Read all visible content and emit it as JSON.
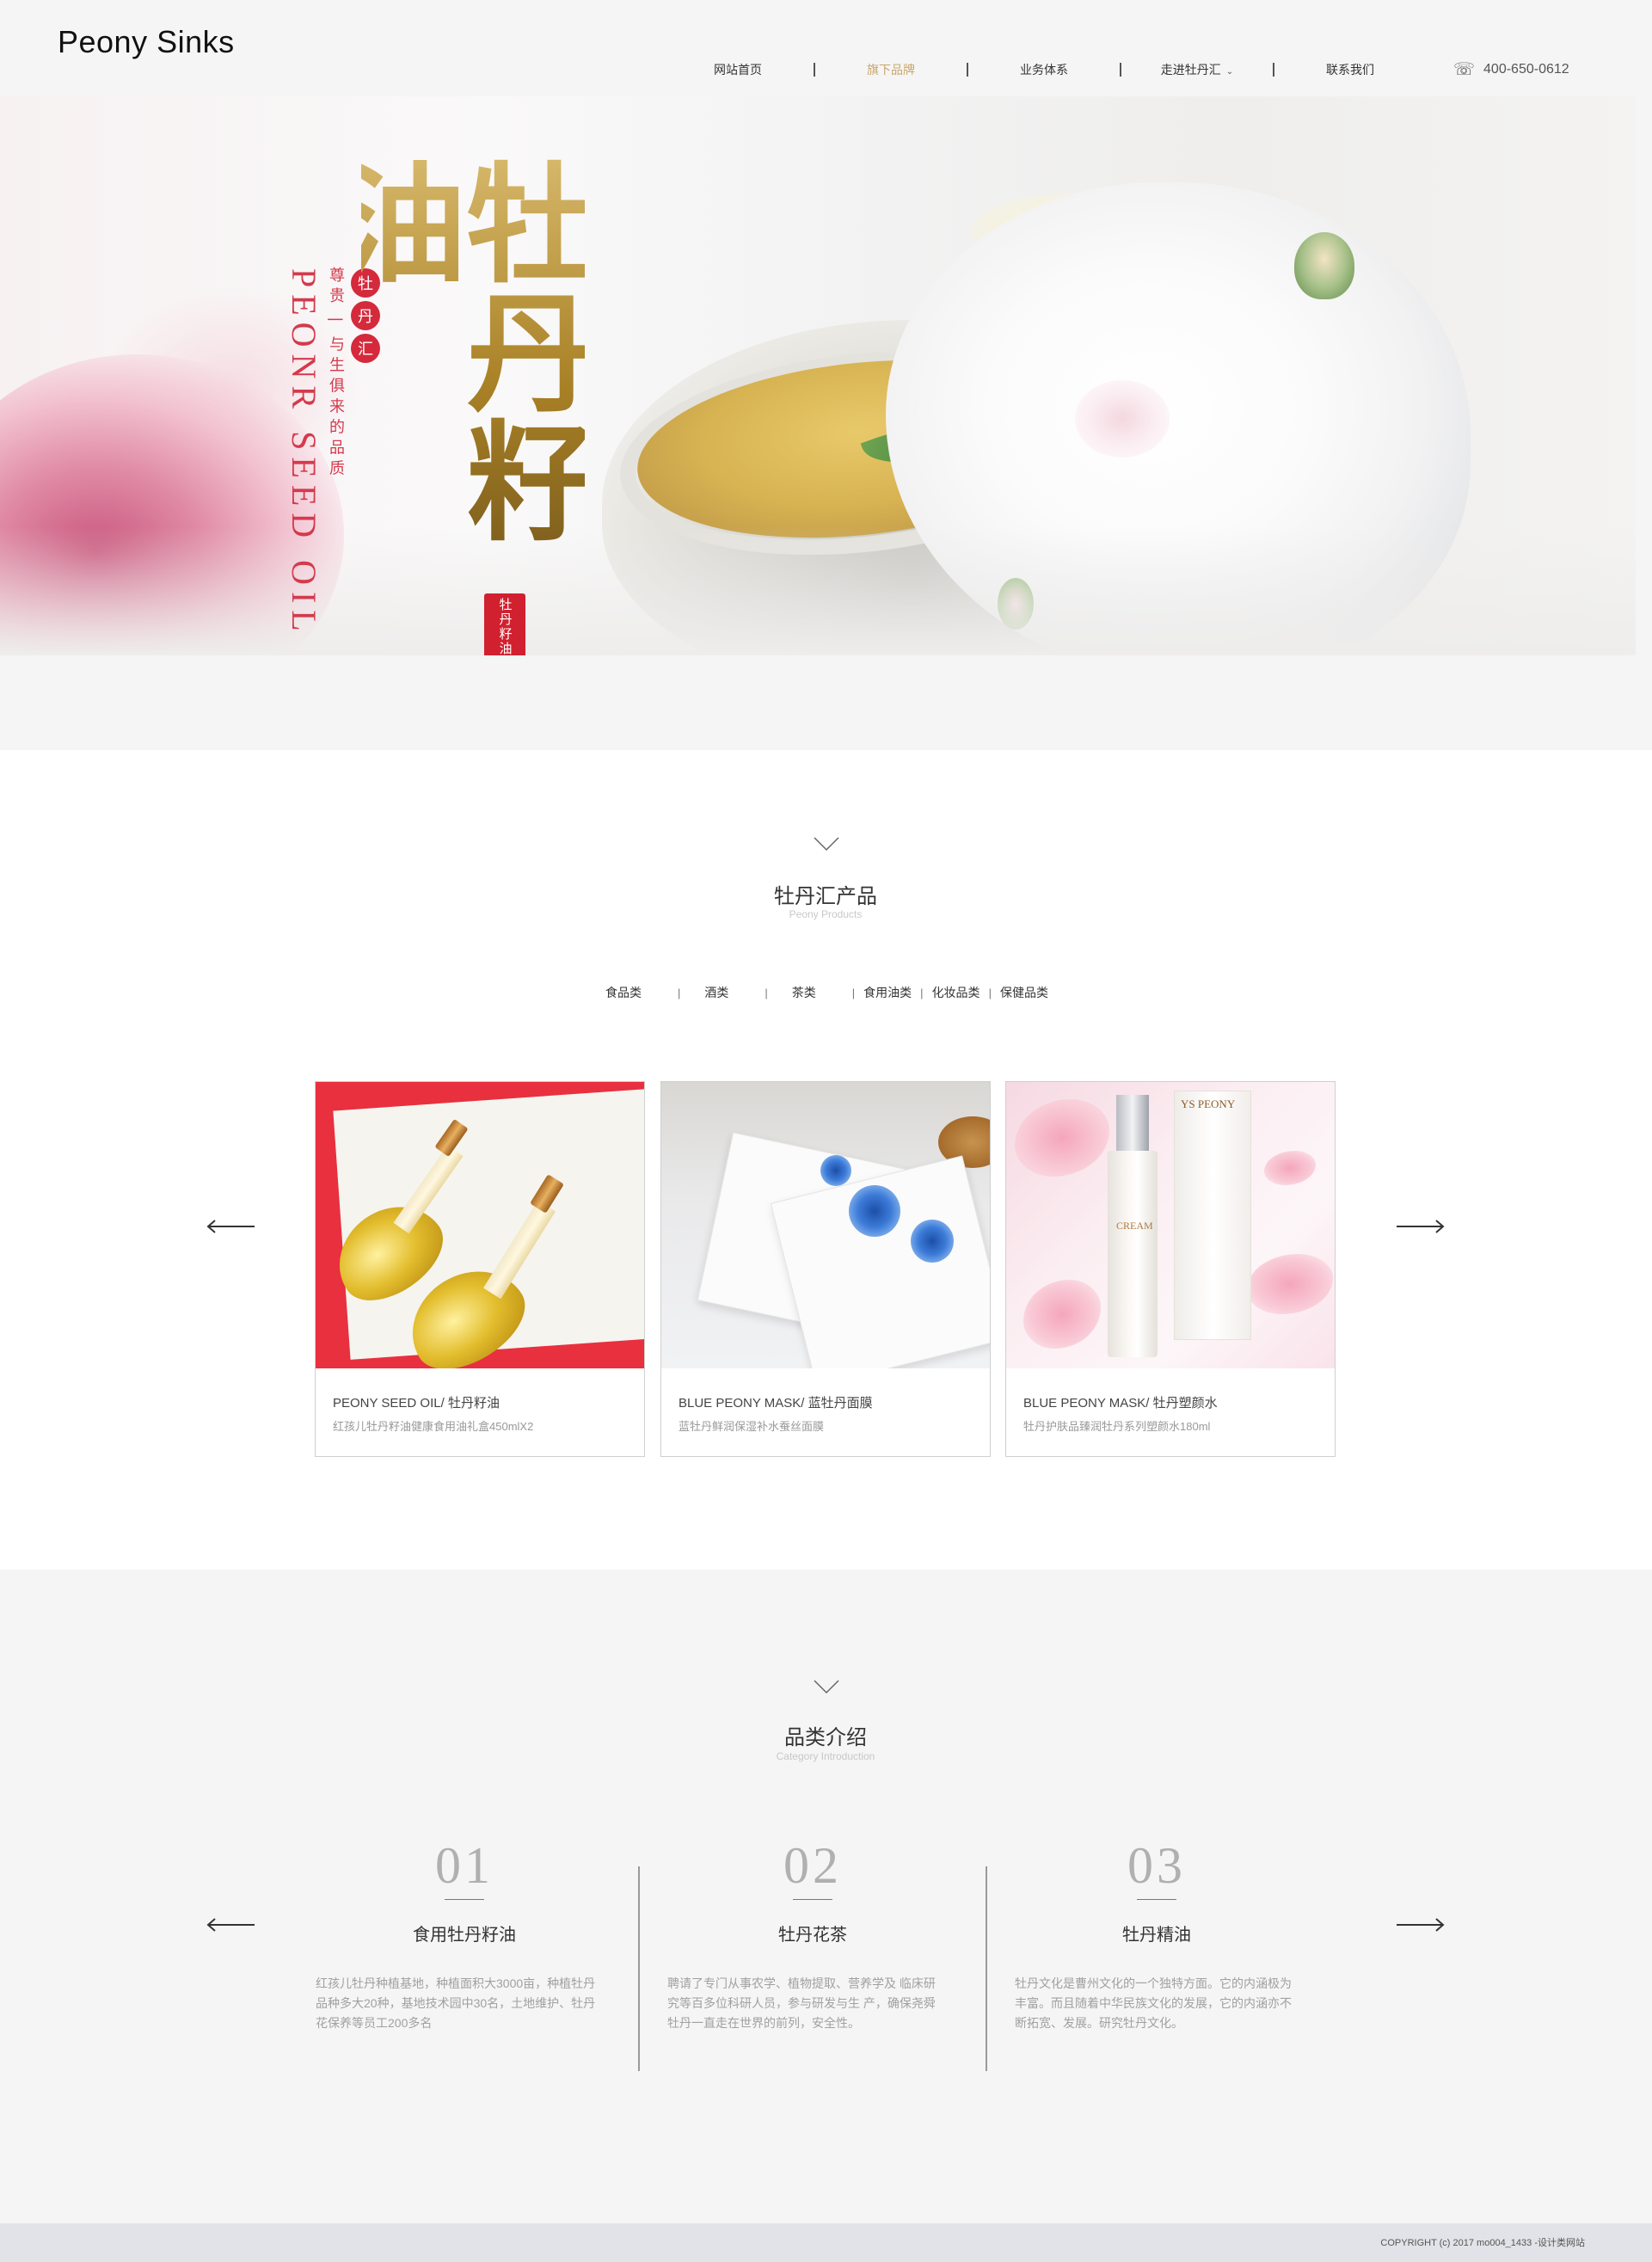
{
  "header": {
    "logo": "Peony Sinks",
    "nav": [
      {
        "label": "网站首页",
        "active": false
      },
      {
        "label": "旗下品牌",
        "active": true
      },
      {
        "label": "业务体系",
        "active": false
      },
      {
        "label": "走进牡丹汇",
        "active": false,
        "has_dropdown": true
      },
      {
        "label": "联系我们",
        "active": false
      }
    ],
    "phone_icon": "telephone-icon",
    "phone": "400-650-0612",
    "active_color": "#c9a66b"
  },
  "banner": {
    "english": "PEONR SEED OIL",
    "slogan": "尊贵 | 与生俱来的品质",
    "seal_chars": [
      "牡",
      "丹",
      "汇"
    ],
    "calligraphy": "牡丹籽油",
    "stamp": "牡丹籽油"
  },
  "products": {
    "title": "牡丹汇产品",
    "subtitle": "Peony Products",
    "categories": [
      "食品类",
      "酒类",
      "茶类",
      "食用油类",
      "化妆品类",
      "保健品类"
    ],
    "cards": [
      {
        "title": "PEONY SEED OIL/ 牡丹籽油",
        "desc": "红孩儿牡丹籽油健康食用油礼盒450mlX2"
      },
      {
        "title": "BLUE PEONY MASK/ 蓝牡丹面膜",
        "desc": "蓝牡丹鲜润保湿补水蚕丝面膜"
      },
      {
        "title": "BLUE PEONY MASK/ 牡丹塑颜水",
        "desc": "牡丹护肤品臻润牡丹系列塑颜水180ml"
      }
    ],
    "card3_box_text": "YS PEONY",
    "card3_bottle_text": "CREAM"
  },
  "category": {
    "title": "品类介绍",
    "subtitle": "Category Introduction",
    "items": [
      {
        "num": "01",
        "title": "食用牡丹籽油",
        "lines": [
          "红孩儿牡丹种植基地，种植面积大3000亩，种植牡丹",
          "品种多大20种，基地技术园中30名，土地维护、牡丹",
          "花保养等员工200多名"
        ]
      },
      {
        "num": "02",
        "title": "牡丹花茶",
        "lines": [
          "聘请了专门从事农学、植物提取、营养学及 临床研",
          "究等百多位科研人员，参与研发与生 产，确保尧舜",
          "牡丹一直走在世界的前列，安全性。"
        ]
      },
      {
        "num": "03",
        "title": "牡丹精油",
        "lines": [
          "牡丹文化是曹州文化的一个独特方面。它的内涵极为",
          "丰富。而且随着中华民族文化的发展，它的内涵亦不",
          "断拓宽、发展。研究牡丹文化。"
        ]
      }
    ]
  },
  "footer": {
    "copyright": "COPYRIGHT (c) 2017 mo004_1433 -设计类网站"
  }
}
